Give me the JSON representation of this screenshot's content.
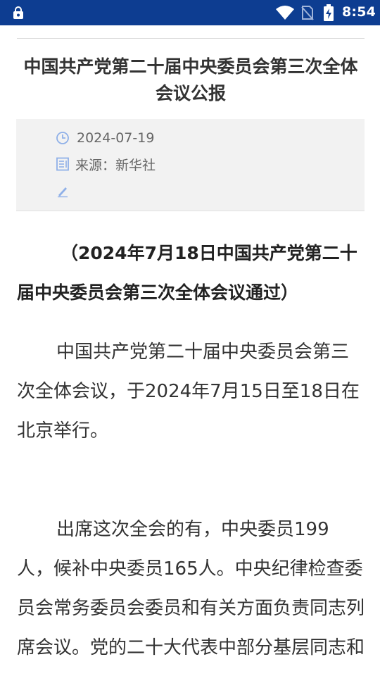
{
  "status_bar": {
    "time": "8:54",
    "icons": [
      "lock-icon",
      "wifi-icon",
      "no-sim-icon",
      "battery-charging-icon"
    ]
  },
  "article": {
    "title": "中国共产党第二十届中央委员会第三次全体会议公报",
    "date": "2024-07-19",
    "source": "来源：新华社",
    "subtitle": "（2024年7月18日中国共产党第二十届中央委员会第三次全体会议通过）",
    "paragraphs": [
      "中国共产党第二十届中央委员会第三次全体会议，于2024年7月15日至18日在北京举行。",
      "出席这次全会的有，中央委员199人，候补中央委员165人。中央纪律检查委员会常务委员会委员和有关方面负责同志列席会议。党的二十大代表中部分基层同志和专家学者也列席了会议。"
    ]
  },
  "colors": {
    "status_bar": "#0d3d91",
    "meta_bg": "#f2f2f2",
    "icon_blue": "#8fb0e8"
  }
}
